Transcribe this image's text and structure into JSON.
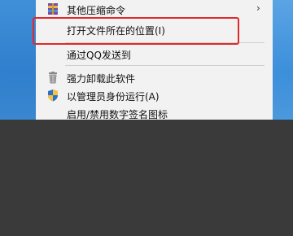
{
  "menu": {
    "items": [
      {
        "label": "其他压缩命令",
        "icon": "archive-icon",
        "has_submenu": true
      },
      {
        "label": "打开文件所在的位置(I)",
        "icon": "",
        "has_submenu": false
      },
      {
        "label": "通过QQ发送到",
        "icon": "",
        "has_submenu": false
      },
      {
        "label": "强力卸载此软件",
        "icon": "trash-icon",
        "has_submenu": false
      },
      {
        "label": "以管理员身份运行(A)",
        "icon": "uac-shield-icon",
        "has_submenu": false
      },
      {
        "label": "启用/禁用数字签名图标",
        "icon": "",
        "has_submenu": false
      }
    ],
    "submenu_arrow": "›"
  },
  "colors": {
    "highlight_border": "#e0292c",
    "menu_background": "#f2f2f2",
    "overlay_background": "#3a3a3a"
  }
}
